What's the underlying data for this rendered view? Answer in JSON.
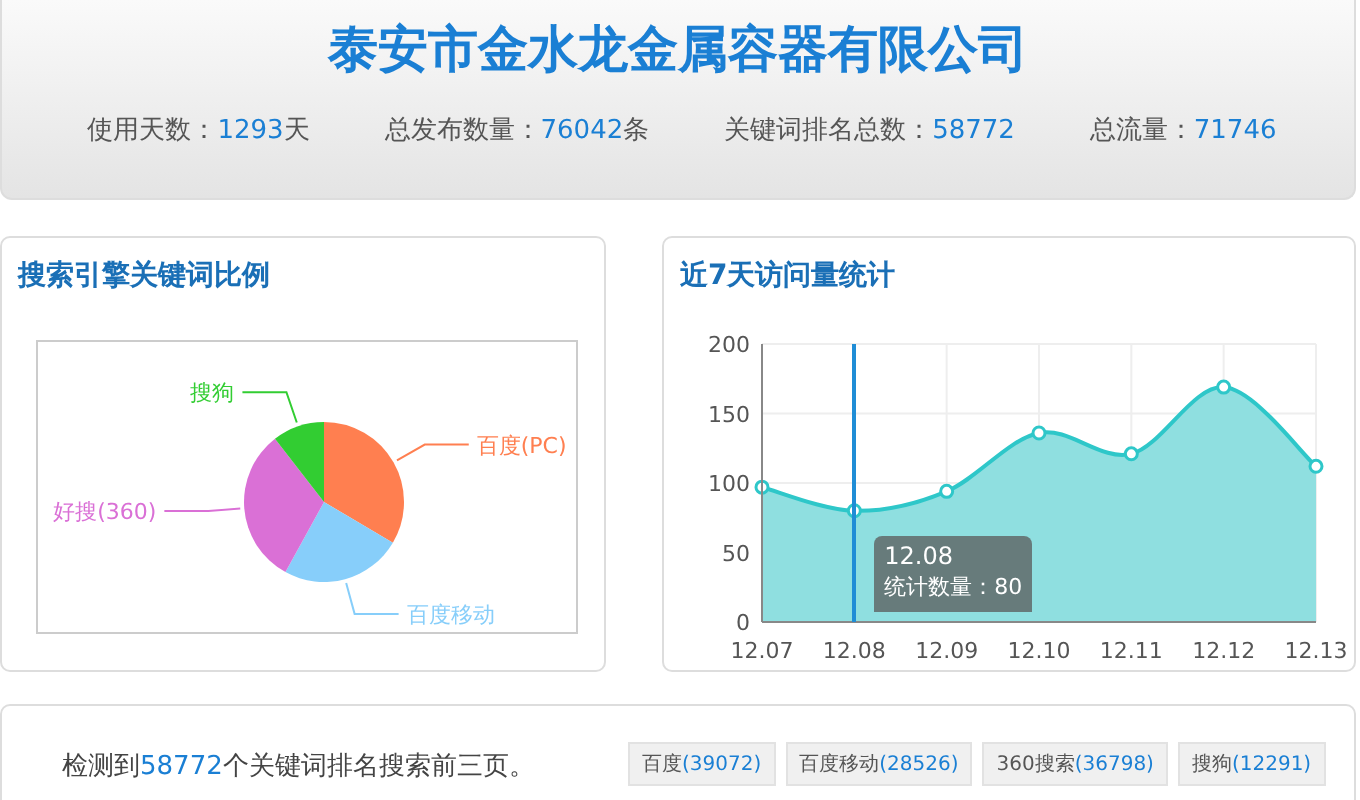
{
  "header": {
    "title": "泰安市金水龙金属容器有限公司",
    "stats": [
      {
        "label": "使用天数：",
        "value": "1293",
        "unit": "天"
      },
      {
        "label": "总发布数量：",
        "value": "76042",
        "unit": "条"
      },
      {
        "label": "关键词排名总数：",
        "value": "58772"
      },
      {
        "label": "总流量：",
        "value": "71746"
      }
    ]
  },
  "pie_panel": {
    "title": "搜索引擎关键词比例",
    "chart_data": {
      "type": "pie",
      "categories": [
        "百度(PC)",
        "百度移动",
        "好搜(360)",
        "搜狗"
      ],
      "series": [
        {
          "colors": [
            "#ff7f50",
            "#87cefa",
            "#da70d6",
            "#32cd32"
          ],
          "values": [
            33.5,
            24.5,
            31.5,
            10.5
          ]
        }
      ]
    }
  },
  "line_panel": {
    "title": "近7天访问量统计",
    "chart_data": {
      "type": "area",
      "categories": [
        "12.07",
        "12.08",
        "12.09",
        "12.10",
        "12.11",
        "12.12",
        "12.13"
      ],
      "ylim": [
        0,
        200
      ],
      "yticks": [
        0,
        50,
        100,
        150,
        200
      ],
      "grid": true,
      "series": [
        {
          "color": "#2ec7c9",
          "values": [
            97,
            80,
            94,
            136,
            121,
            169,
            112
          ]
        }
      ]
    },
    "tooltip": {
      "title": "12.08",
      "text": "统计数量：80"
    }
  },
  "summary": {
    "prefix": "检测到",
    "count": "58772",
    "suffix": "个关键词排名搜索前三页。",
    "engines": [
      {
        "name": "百度",
        "count": "(39072)"
      },
      {
        "name": "百度移动",
        "count": "(28526)"
      },
      {
        "name": "360搜索",
        "count": "(36798)"
      },
      {
        "name": "搜狗",
        "count": "(12291)"
      }
    ]
  }
}
